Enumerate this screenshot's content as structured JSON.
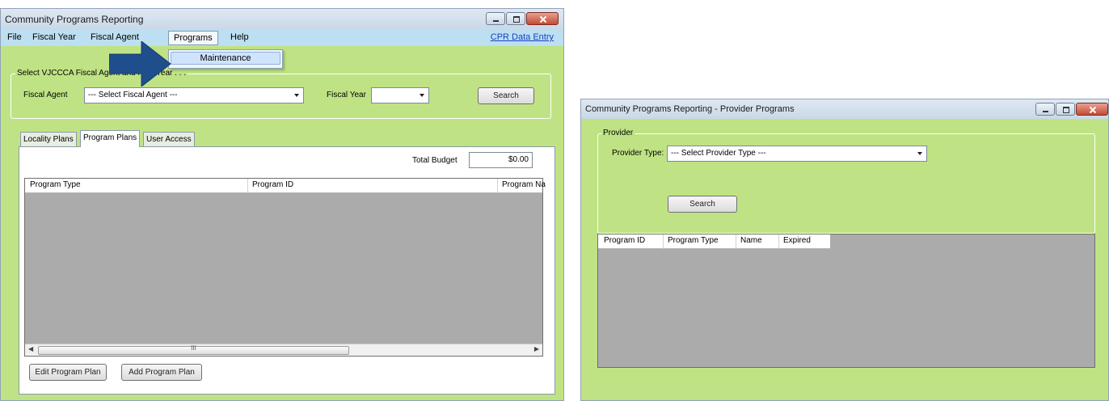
{
  "main_window": {
    "title": "Community Programs Reporting",
    "menu": {
      "items": [
        "File",
        "Fiscal Year",
        "Fiscal Agent",
        "Programs",
        "Help"
      ],
      "open_menu": "Programs",
      "dropdown_items": [
        "Maintenance"
      ],
      "data_entry_link": "CPR Data Entry"
    },
    "selection_group": {
      "legend": "Select VJCCCA Fiscal Agent and Plan Year . . .",
      "fiscal_agent_label": "Fiscal Agent",
      "fiscal_agent_value": "--- Select Fiscal Agent ---",
      "fiscal_year_label": "Fiscal Year",
      "fiscal_year_value": "",
      "search_button": "Search"
    },
    "tabs": [
      {
        "label": "Locality Plans",
        "active": false
      },
      {
        "label": "Program Plans",
        "active": true
      },
      {
        "label": "User Access",
        "active": false
      }
    ],
    "total_budget_label": "Total Budget",
    "total_budget_value": "$0.00",
    "grid_columns": [
      "Program Type",
      "Program ID",
      "Program Na"
    ],
    "scroll_thumb_grip": "III",
    "edit_button": "Edit Program Plan",
    "add_button": "Add Program Plan"
  },
  "provider_window": {
    "title": "Community Programs Reporting - Provider Programs",
    "group_legend": "Provider",
    "provider_type_label": "Provider Type:",
    "provider_type_value": "--- Select Provider Type ---",
    "search_button": "Search",
    "grid_columns": [
      "Program ID",
      "Program Type",
      "Name",
      "Expired"
    ]
  },
  "annotation": {
    "arrow_color": "#1f4e8c"
  },
  "colors": {
    "client_bg": "#bfe384",
    "menubar_bg": "#bcdff1",
    "grid_bg": "#ababab"
  }
}
